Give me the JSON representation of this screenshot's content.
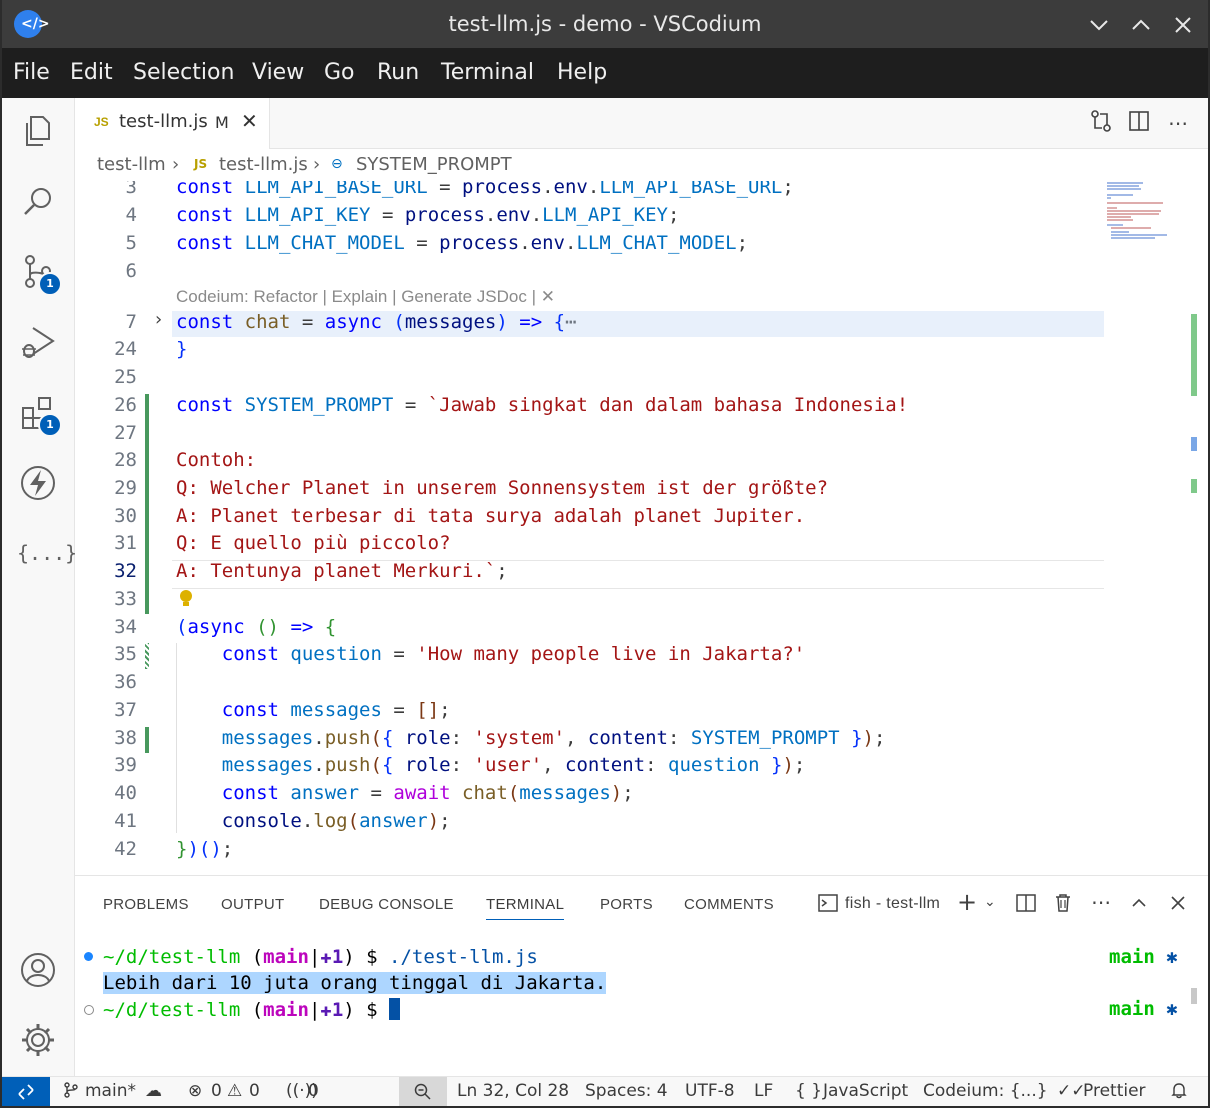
{
  "window": {
    "title": "test-llm.js - demo - VSCodium"
  },
  "menu": [
    "File",
    "Edit",
    "Selection",
    "View",
    "Go",
    "Run",
    "Terminal",
    "Help"
  ],
  "activity": {
    "scm_badge": "1",
    "extensions_badge": "1",
    "braces_label": "{...}"
  },
  "tab": {
    "icon": "JS",
    "name": "test-llm.js",
    "status": "M"
  },
  "breadcrumb": {
    "folder": "test-llm",
    "file": "test-llm.js",
    "symbol": "SYSTEM_PROMPT",
    "file_icon": "JS"
  },
  "editor": {
    "line_numbers": [
      "3",
      "4",
      "5",
      "6",
      "7",
      "24",
      "25",
      "26",
      "27",
      "28",
      "29",
      "30",
      "31",
      "32",
      "33",
      "34",
      "35",
      "36",
      "37",
      "38",
      "39",
      "40",
      "41",
      "42"
    ],
    "codelens": "Codeium: Refactor | Explain | Generate JSDoc | ✕",
    "current_line": "32"
  },
  "panel": {
    "tabs": [
      "PROBLEMS",
      "OUTPUT",
      "DEBUG CONSOLE",
      "TERMINAL",
      "PORTS",
      "COMMENTS"
    ],
    "active_tab": "TERMINAL",
    "terminal_name": "fish - test-llm"
  },
  "terminal": {
    "prompt_path": "~/d/test-llm",
    "branch": "main",
    "dirty": "✚1",
    "command": "./test-llm.js",
    "output": "Lebih dari 10 juta orang tinggal di Jakarta.",
    "right_branch": "main",
    "right_mark": "✱"
  },
  "status": {
    "branch": "main*",
    "errors": "0",
    "warnings": "0",
    "ports": "0",
    "position": "Ln 32, Col 28",
    "spaces": "Spaces: 4",
    "encoding": "UTF-8",
    "eol": "LF",
    "language": "JavaScript",
    "codeium": "Codeium: {...}",
    "prettier": "Prettier"
  }
}
